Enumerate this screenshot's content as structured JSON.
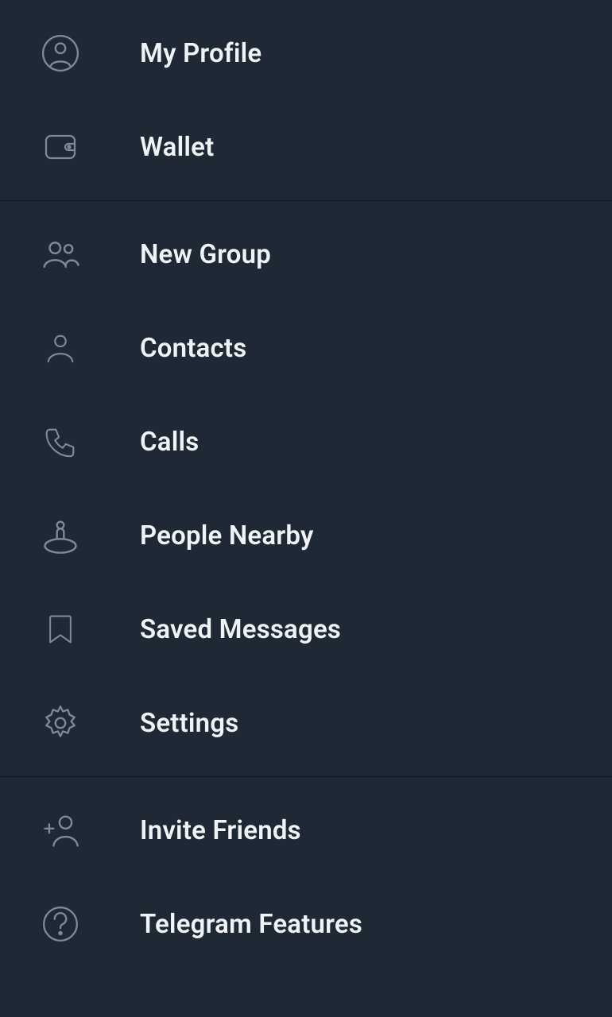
{
  "menu": {
    "section1": [
      {
        "label": "My Profile"
      },
      {
        "label": "Wallet"
      }
    ],
    "section2": [
      {
        "label": "New Group"
      },
      {
        "label": "Contacts"
      },
      {
        "label": "Calls"
      },
      {
        "label": "People Nearby"
      },
      {
        "label": "Saved Messages"
      },
      {
        "label": "Settings"
      }
    ],
    "section3": [
      {
        "label": "Invite Friends"
      },
      {
        "label": "Telegram Features"
      }
    ]
  }
}
